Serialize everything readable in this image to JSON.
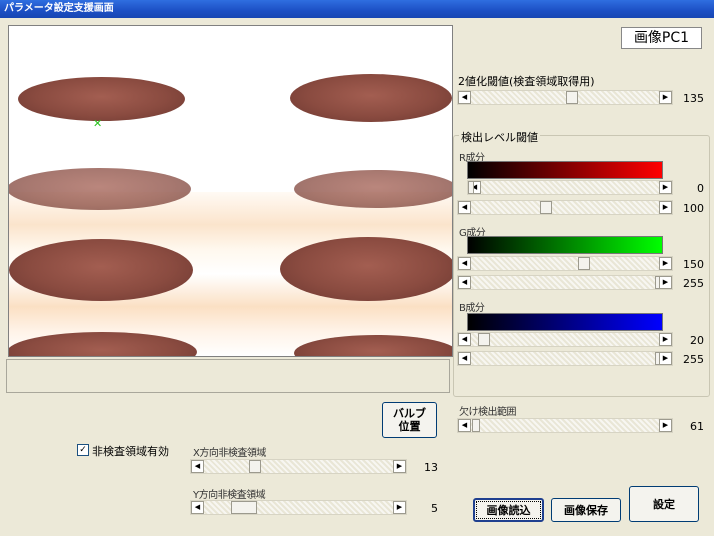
{
  "window": {
    "title": "パラメータ設定支援画面"
  },
  "camera_label": "画像PC1",
  "binarize": {
    "label": "2値化閾値(検査領域取得用)",
    "value": "135"
  },
  "detect_group": {
    "title": "検出レベル閾値",
    "red": {
      "label": "R成分",
      "low": "0",
      "high": "100",
      "color": "#ff0000"
    },
    "green": {
      "label": "G成分",
      "low": "150",
      "high": "255",
      "color": "#00ff00"
    },
    "blue": {
      "label": "B成分",
      "low": "20",
      "high": "255",
      "color": "#0000ff"
    }
  },
  "bottom_right_param": {
    "label": "欠け検出範囲",
    "value": "61"
  },
  "checkbox": {
    "label": "非検査領域有効",
    "checked": true,
    "mark": "✓"
  },
  "x_region": {
    "label": "X方向非検査領域",
    "value": "13"
  },
  "y_region": {
    "label": "Y方向非検査領域",
    "value": "5"
  },
  "buttons": {
    "valve_position": "バルブ\n位置",
    "load_image": "画像読込",
    "save_image": "画像保存",
    "settings": "設定"
  },
  "scroll_arrows": {
    "left": "◀",
    "right": "▶"
  },
  "colors": {
    "titlebar": "#1c4fc4",
    "background": "#ece9d8",
    "object": "#8a4b40"
  }
}
